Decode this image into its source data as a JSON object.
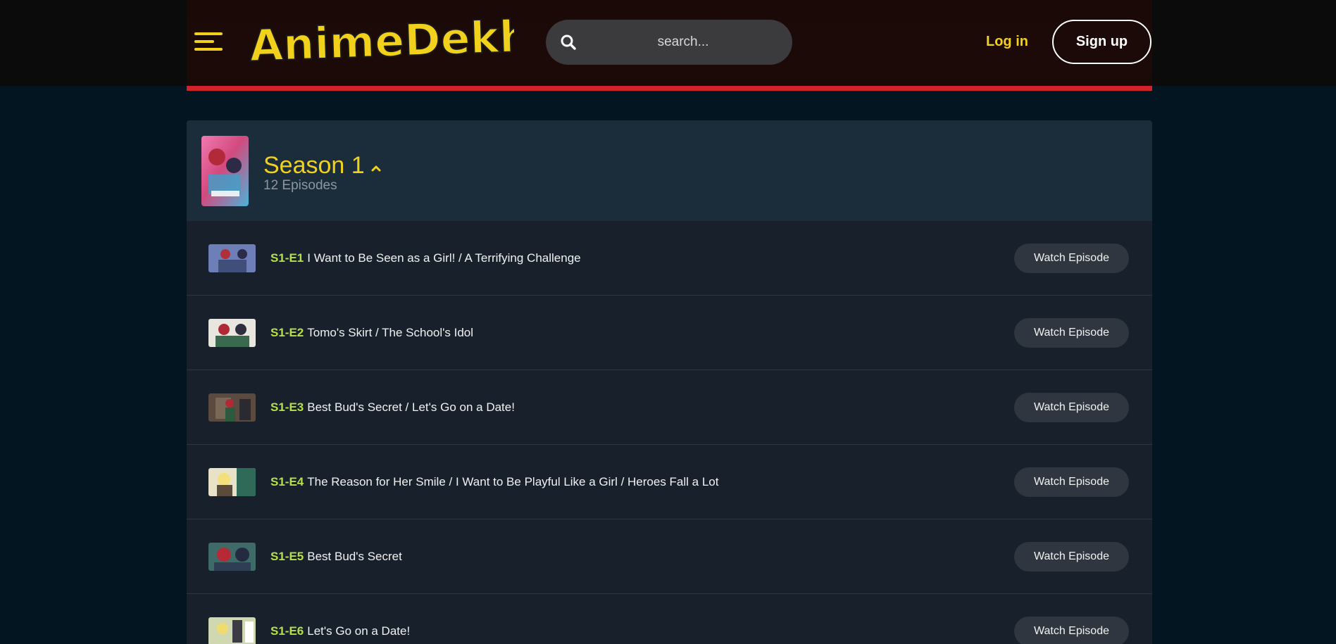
{
  "header": {
    "logo_text": "AnimeDekho",
    "search_placeholder": "search...",
    "login_label": "Log in",
    "signup_label": "Sign up"
  },
  "colors": {
    "accent_yellow": "#f2d11c",
    "header_red": "#d2232a",
    "episode_code_green": "#b6e04a",
    "page_bg": "#021520",
    "season_header_bg": "#1b2c3a",
    "row_bg": "#18212b"
  },
  "icons": {
    "menu": "hamburger-menu-icon",
    "search": "search-icon",
    "collapse": "chevron-up-icon"
  },
  "season": {
    "title": "Season 1",
    "episode_count": "12 Episodes",
    "expanded": true
  },
  "episodes": [
    {
      "code": "S1-E1",
      "title": "I Want to Be Seen as a Girl! / A Terrifying Challenge",
      "button": "Watch Episode"
    },
    {
      "code": "S1-E2",
      "title": "Tomo's Skirt / The School's Idol",
      "button": "Watch Episode"
    },
    {
      "code": "S1-E3",
      "title": "Best Bud's Secret / Let's Go on a Date!",
      "button": "Watch Episode"
    },
    {
      "code": "S1-E4",
      "title": "The Reason for Her Smile / I Want to Be Playful Like a Girl / Heroes Fall a Lot",
      "button": "Watch Episode"
    },
    {
      "code": "S1-E5",
      "title": "Best Bud's Secret",
      "button": "Watch Episode"
    },
    {
      "code": "S1-E6",
      "title": "Let's Go on a Date!",
      "button": "Watch Episode"
    }
  ]
}
